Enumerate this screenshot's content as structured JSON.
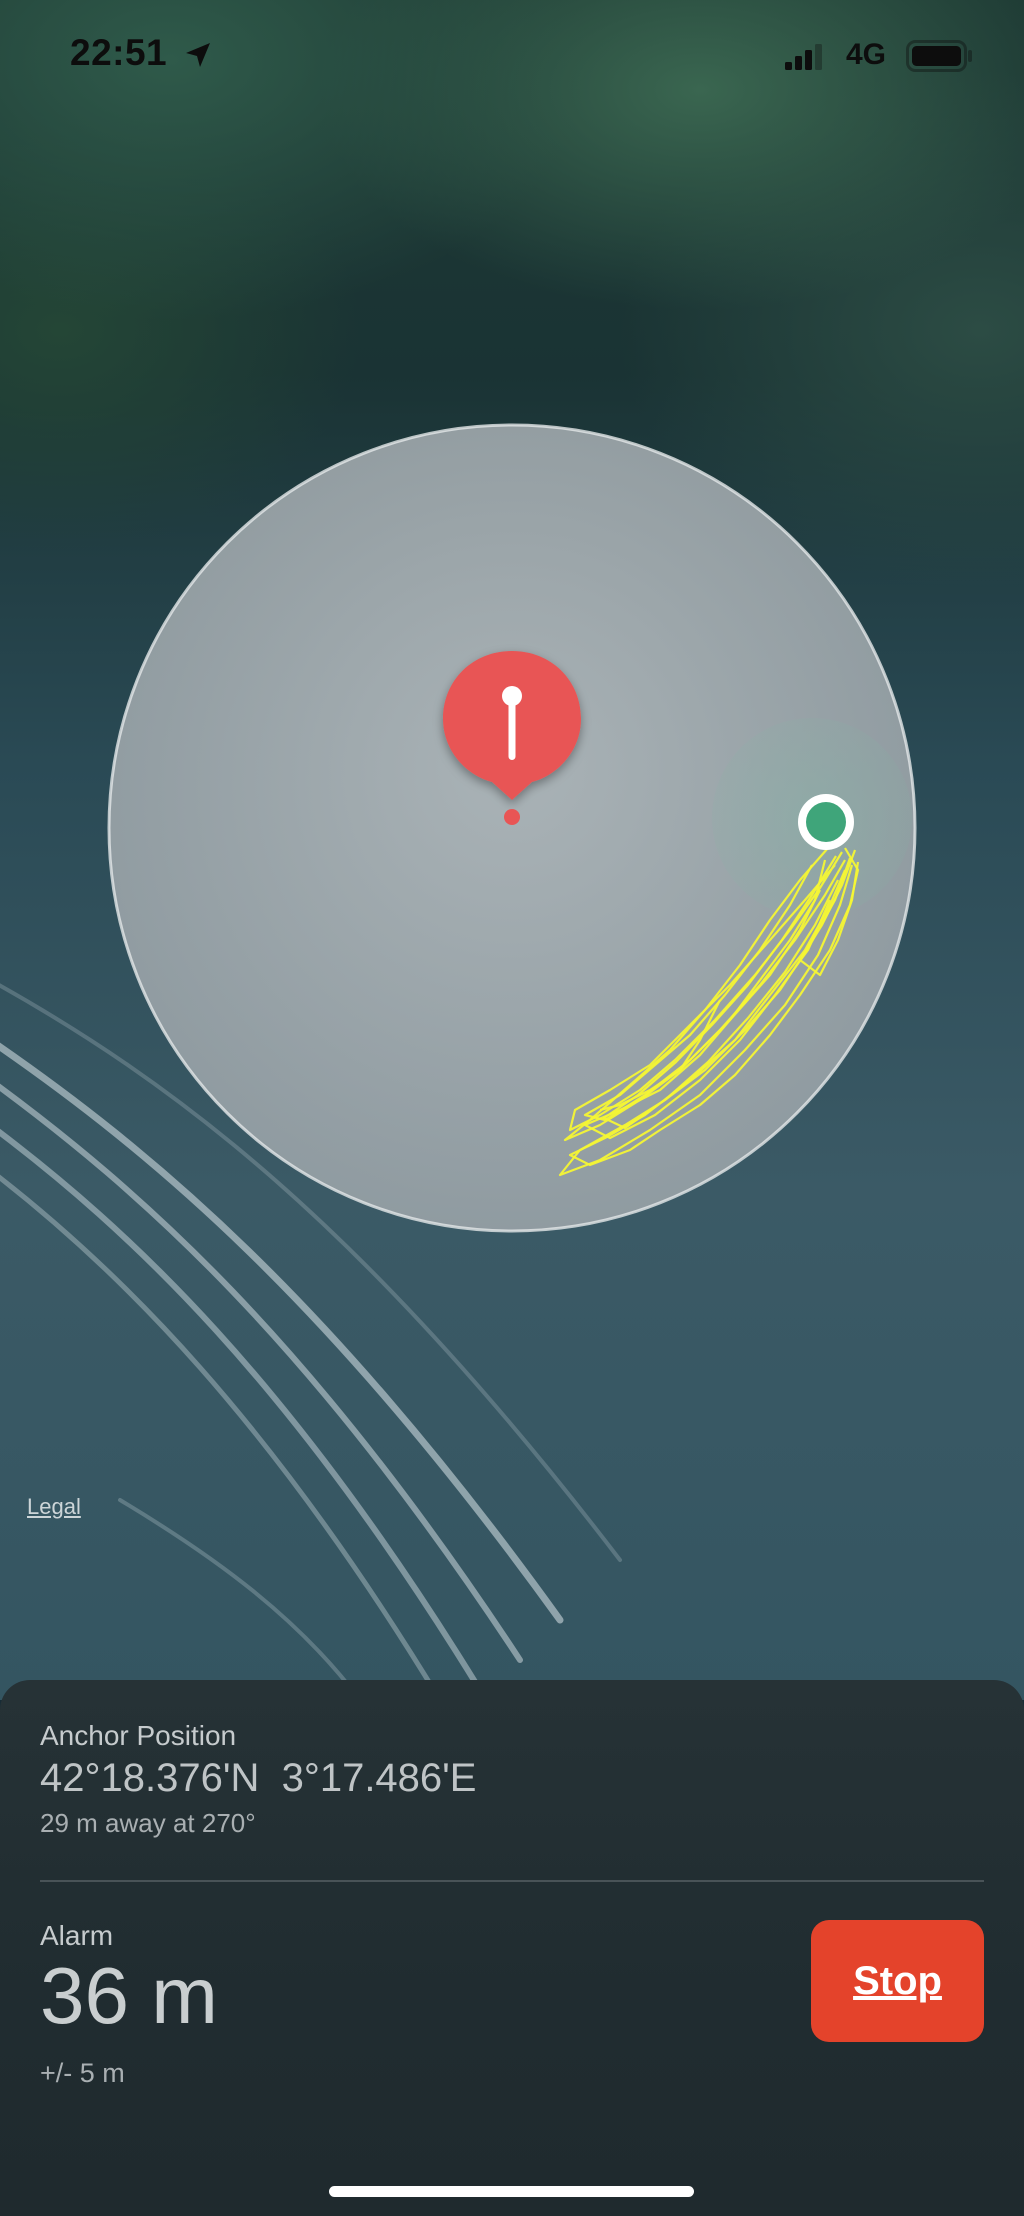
{
  "status_bar": {
    "time": "22:51",
    "network": "4G",
    "icons": [
      "location-arrow-icon",
      "cellular-signal-icon",
      "battery-icon"
    ]
  },
  "map": {
    "legal_label": "Legal",
    "anchor_icon": "anchor-pin-icon",
    "boat_icon": "boat-position-icon",
    "colors": {
      "pin": "#e85555",
      "boat": "#3fa57a",
      "track": "#f4f534"
    }
  },
  "panel": {
    "anchor_label": "Anchor Position",
    "anchor_coords": "42°18.376'N  3°17.486'E",
    "anchor_distance": "29 m away at 270°",
    "alarm_label": "Alarm",
    "alarm_radius": "36 m",
    "alarm_tolerance": "+/- 5 m",
    "stop_label": "Stop",
    "stop_color": "#e4432b"
  }
}
